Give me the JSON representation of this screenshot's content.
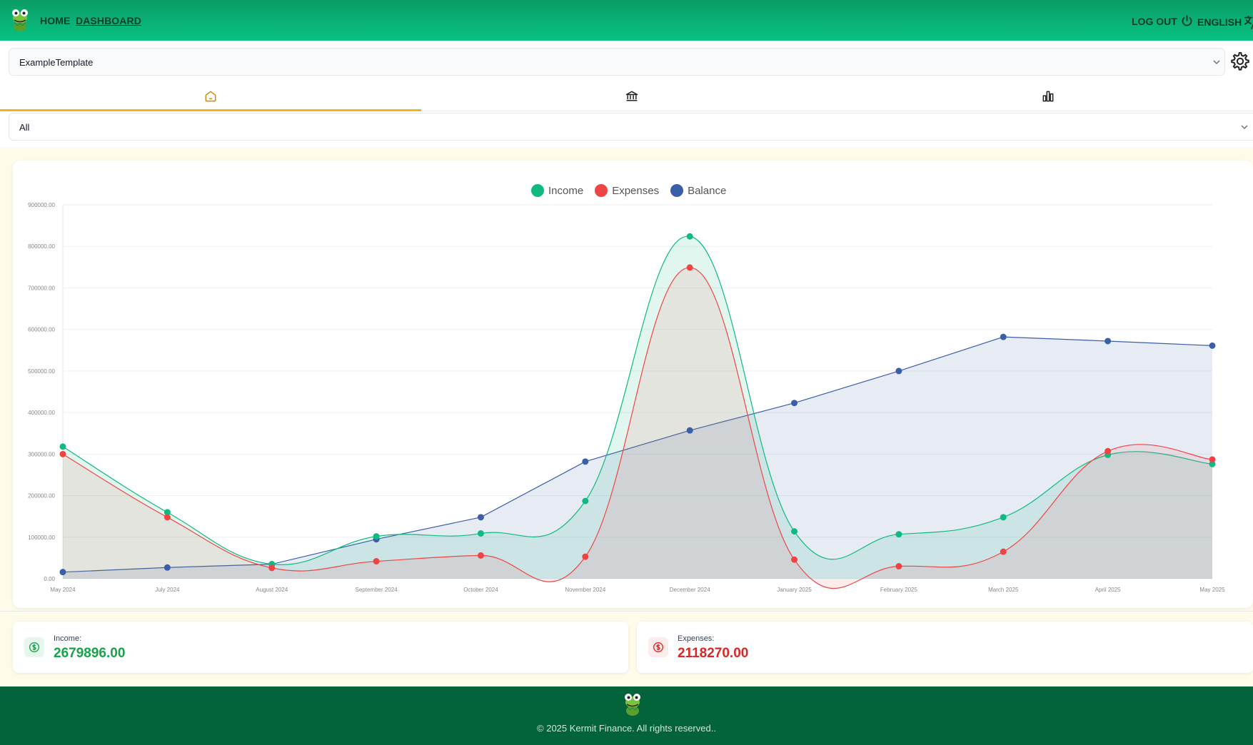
{
  "header": {
    "nav": {
      "home": "HOME",
      "dashboard": "DASHBOARD"
    },
    "logout_label": "LOG OUT",
    "language_label": "ENGLISH",
    "icons": [
      "frog-logo",
      "power-icon",
      "translate-icon"
    ]
  },
  "template_select": {
    "value": "ExampleTemplate"
  },
  "tabs": [
    {
      "icon": "home-icon",
      "active": true
    },
    {
      "icon": "bank-icon",
      "active": false
    },
    {
      "icon": "bar-chart-icon",
      "active": false
    }
  ],
  "filter_select": {
    "value": "All"
  },
  "chart_data": {
    "type": "area",
    "categories": [
      "May 2024",
      "July 2024",
      "August 2024",
      "September 2024",
      "October 2024",
      "November 2024",
      "December 2024",
      "January 2025",
      "February 2025",
      "March 2025",
      "April 2025",
      "May 2025"
    ],
    "y_tick_labels": [
      "0.00",
      "100000.00",
      "200000.00",
      "300000.00",
      "400000.00",
      "500000.00",
      "600000.00",
      "700000.00",
      "800000.00",
      "900000.00"
    ],
    "ylim": [
      0,
      900000
    ],
    "grid": true,
    "legend_placement": "top-center",
    "series": [
      {
        "name": "Income",
        "color": "#10b981",
        "values": [
          318000,
          160000,
          35000,
          102000,
          109000,
          187000,
          824000,
          114000,
          107000,
          148000,
          298000,
          276000
        ]
      },
      {
        "name": "Expenses",
        "color": "#ef4444",
        "values": [
          300000,
          148000,
          26000,
          42000,
          56000,
          53000,
          749000,
          46000,
          30000,
          65000,
          307000,
          287000
        ]
      },
      {
        "name": "Balance",
        "color": "#3b5ea8",
        "values": [
          16000,
          27000,
          35000,
          95000,
          148000,
          282000,
          357000,
          423000,
          500000,
          582000,
          572000,
          561000
        ]
      }
    ]
  },
  "stats": {
    "income": {
      "label": "Income:",
      "value": "2679896.00",
      "color": "#16a34a"
    },
    "expenses": {
      "label": "Expenses:",
      "value": "2118270.00",
      "color": "#dc2626"
    }
  },
  "footer": {
    "copyright": "© 2025 Kermit Finance. All rights reserved.."
  }
}
